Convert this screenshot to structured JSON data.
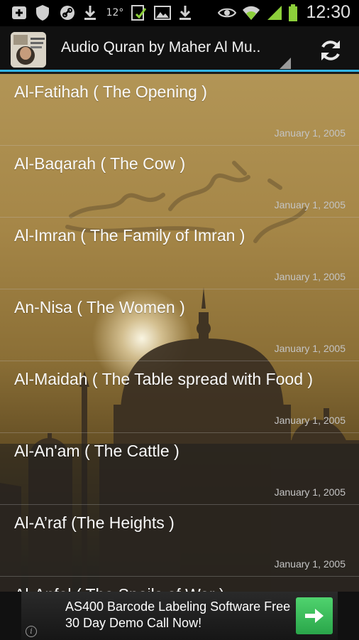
{
  "status_bar": {
    "time": "12:30",
    "temperature": "12°",
    "icons": [
      "add-icon",
      "shield-icon",
      "link-icon",
      "download-icon",
      "temperature",
      "clipboard-check-icon",
      "image-icon",
      "download-icon",
      "eye-icon",
      "wifi-icon",
      "signal-icon",
      "battery-icon"
    ]
  },
  "action_bar": {
    "title": "Audio Quran by Maher Al Mu..",
    "refresh_icon": "refresh-icon",
    "accent_color": "#33b5e5"
  },
  "list": {
    "items": [
      {
        "title": "Al-Fatihah ( The Opening )",
        "date": "January 1, 2005"
      },
      {
        "title": "Al-Baqarah ( The Cow )",
        "date": "January 1, 2005"
      },
      {
        "title": "Al-Imran ( The Family of Imran )",
        "date": "January 1, 2005"
      },
      {
        "title": "An-Nisa ( The Women )",
        "date": "January 1, 2005"
      },
      {
        "title": "Al-Maidah ( The Table spread with Food )",
        "date": "January 1, 2005"
      },
      {
        "title": "Al-An'am ( The Cattle )",
        "date": "January 1, 2005"
      },
      {
        "title": "Al-A’raf (The Heights )",
        "date": "January 1, 2005"
      },
      {
        "title": "Al-Anfal ( The Spoils of War )",
        "date": ""
      }
    ]
  },
  "ad": {
    "line1": "AS400 Barcode Labeling Software Free",
    "line2": "30 Day Demo Call Now!",
    "info_symbol": "i",
    "arrow_icon": "arrow-right-icon",
    "button_color": "#3cbf5c"
  }
}
